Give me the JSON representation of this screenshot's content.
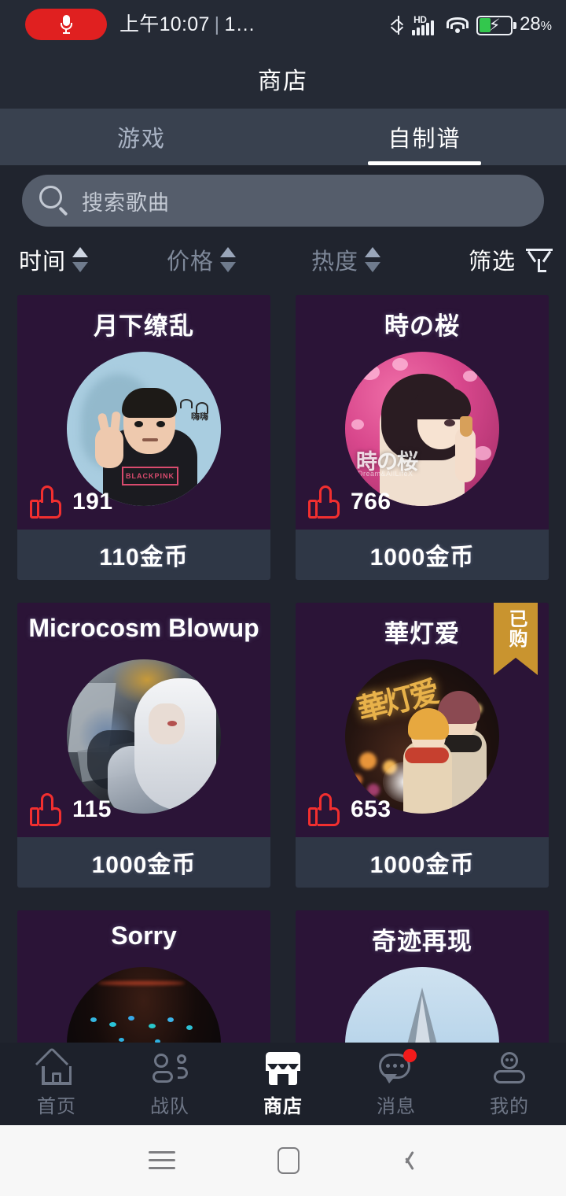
{
  "status_bar": {
    "mic_icon": "microphone-icon",
    "time": "上午10:07",
    "separator": "|",
    "extra_text": "1…",
    "bluetooth_icon": "bluetooth-icon",
    "hd_label": "HD",
    "signal_icon": "cellular-signal-icon",
    "wifi_icon": "wifi-icon",
    "battery_icon": "battery-charging-icon",
    "battery_percent": "28%",
    "battery_percent_number": "28",
    "battery_percent_symbol": "%"
  },
  "header": {
    "title": "商店"
  },
  "tabs": [
    {
      "label": "游戏",
      "active": false
    },
    {
      "label": "自制谱",
      "active": true
    }
  ],
  "search": {
    "placeholder": "搜索歌曲",
    "value": "",
    "icon": "search-icon"
  },
  "sort_bar": {
    "items": [
      {
        "label": "时间",
        "active": true,
        "icon": "sort-arrows-icon"
      },
      {
        "label": "价格",
        "active": false,
        "icon": "sort-arrows-icon"
      },
      {
        "label": "热度",
        "active": false,
        "icon": "sort-arrows-icon"
      }
    ],
    "filter": {
      "label": "筛选",
      "icon": "funnel-filter-icon"
    }
  },
  "cards": [
    {
      "title": "月下缭乱",
      "likes": "191",
      "price": "110金币",
      "purchased": false,
      "badge": "",
      "cover": "person-peace-sign-blackpink-cover"
    },
    {
      "title": "時の桜",
      "likes": "766",
      "price": "1000金币",
      "purchased": false,
      "badge": "",
      "cover": "pink-sakura-anime-girl-cover"
    },
    {
      "title": "Microcosm Blowup",
      "likes": "115",
      "price": "1000金币",
      "purchased": false,
      "badge": "",
      "cover": "white-haired-fantasy-girl-cover"
    },
    {
      "title": "華灯爱",
      "likes": "653",
      "price": "1000金币",
      "purchased": true,
      "badge": "已购",
      "cover": "night-lights-couple-cover"
    },
    {
      "title": "Sorry",
      "likes": "",
      "price": "",
      "purchased": false,
      "badge": "",
      "cover": "dark-concert-crowd-cover"
    },
    {
      "title": "奇迹再现",
      "likes": "",
      "price": "",
      "purchased": false,
      "badge": "",
      "cover": "ice-shard-blue-sky-cover"
    }
  ],
  "bottom_nav": [
    {
      "label": "首页",
      "icon": "home-icon",
      "active": false,
      "badge": false
    },
    {
      "label": "战队",
      "icon": "team-icon",
      "active": false,
      "badge": false
    },
    {
      "label": "商店",
      "icon": "store-icon",
      "active": true,
      "badge": false
    },
    {
      "label": "消息",
      "icon": "message-icon",
      "active": false,
      "badge": true
    },
    {
      "label": "我的",
      "icon": "profile-icon",
      "active": false,
      "badge": false
    }
  ],
  "android_nav": [
    {
      "icon": "recents-icon"
    },
    {
      "icon": "home-square-icon"
    },
    {
      "icon": "back-chevron-icon"
    }
  ],
  "colors": {
    "page_bg": "#20242e",
    "header_bg": "#252a35",
    "tabbar_bg": "#39414f",
    "card_bg": "#2b1437",
    "price_bar_bg": "#2f3746",
    "accent_white": "#ffffff",
    "like_red": "#f22f2f",
    "badge_gold": "#c9942f",
    "notification_red": "#f21b1b",
    "battery_green": "#33c74d",
    "mic_red": "#e02020",
    "muted_text": "#7e8899"
  }
}
